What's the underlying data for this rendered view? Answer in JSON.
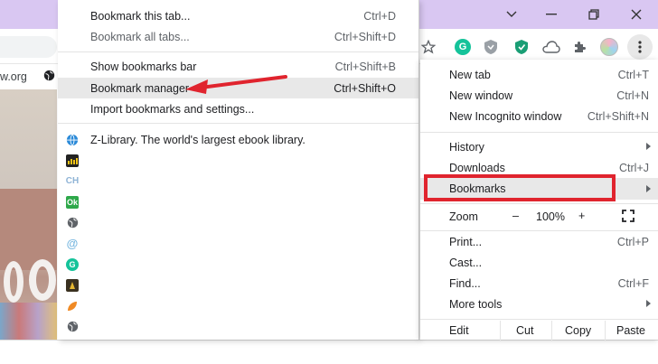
{
  "colors": {
    "accent_red": "#e0242e",
    "titlebar": "#d9c7f2",
    "highlight": "#e8e8e8"
  },
  "window": {
    "minimize_icon": "chevron-down-icon",
    "restore_icon": "restore-icon",
    "close_icon": "close-icon"
  },
  "address": {
    "partial_url": "w.org"
  },
  "bookmarks_submenu": {
    "items": [
      {
        "label": "Bookmark this tab...",
        "shortcut": "Ctrl+D"
      },
      {
        "label": "Bookmark all tabs...",
        "shortcut": "Ctrl+Shift+D"
      },
      {
        "label": "Show bookmarks bar",
        "shortcut": "Ctrl+Shift+B"
      },
      {
        "label": "Bookmark manager",
        "shortcut": "Ctrl+Shift+O"
      },
      {
        "label": "Import bookmarks and settings...",
        "shortcut": ""
      }
    ],
    "bookmarks": [
      {
        "label": "Z-Library. The world's largest ebook library.",
        "icon": "globe-blue-icon"
      },
      {
        "label": "",
        "icon": "dark-favicon-icon"
      },
      {
        "label": "",
        "icon": "ch-favicon-icon",
        "text": "CH"
      },
      {
        "label": "",
        "icon": "ok-favicon-icon",
        "text": "Ok"
      },
      {
        "label": "",
        "icon": "globe-icon"
      },
      {
        "label": "",
        "icon": "at-favicon-icon",
        "text": "@"
      },
      {
        "label": "",
        "icon": "grammarly-icon",
        "text": "G"
      },
      {
        "label": "",
        "icon": "yellow-favicon-icon"
      },
      {
        "label": "",
        "icon": "orange-favicon-icon"
      },
      {
        "label": "",
        "icon": "globe-icon"
      }
    ]
  },
  "main_menu": {
    "new_tab": {
      "label": "New tab",
      "shortcut": "Ctrl+T"
    },
    "new_window": {
      "label": "New window",
      "shortcut": "Ctrl+N"
    },
    "new_incognito": {
      "label": "New Incognito window",
      "shortcut": "Ctrl+Shift+N"
    },
    "history": {
      "label": "History"
    },
    "downloads": {
      "label": "Downloads",
      "shortcut": "Ctrl+J"
    },
    "bookmarks": {
      "label": "Bookmarks"
    },
    "zoom": {
      "label": "Zoom",
      "minus": "–",
      "level": "100%",
      "plus": "+"
    },
    "print": {
      "label": "Print...",
      "shortcut": "Ctrl+P"
    },
    "cast": {
      "label": "Cast..."
    },
    "find": {
      "label": "Find...",
      "shortcut": "Ctrl+F"
    },
    "more_tools": {
      "label": "More tools"
    },
    "edit": {
      "label": "Edit",
      "cut": "Cut",
      "copy": "Copy",
      "paste": "Paste"
    }
  }
}
